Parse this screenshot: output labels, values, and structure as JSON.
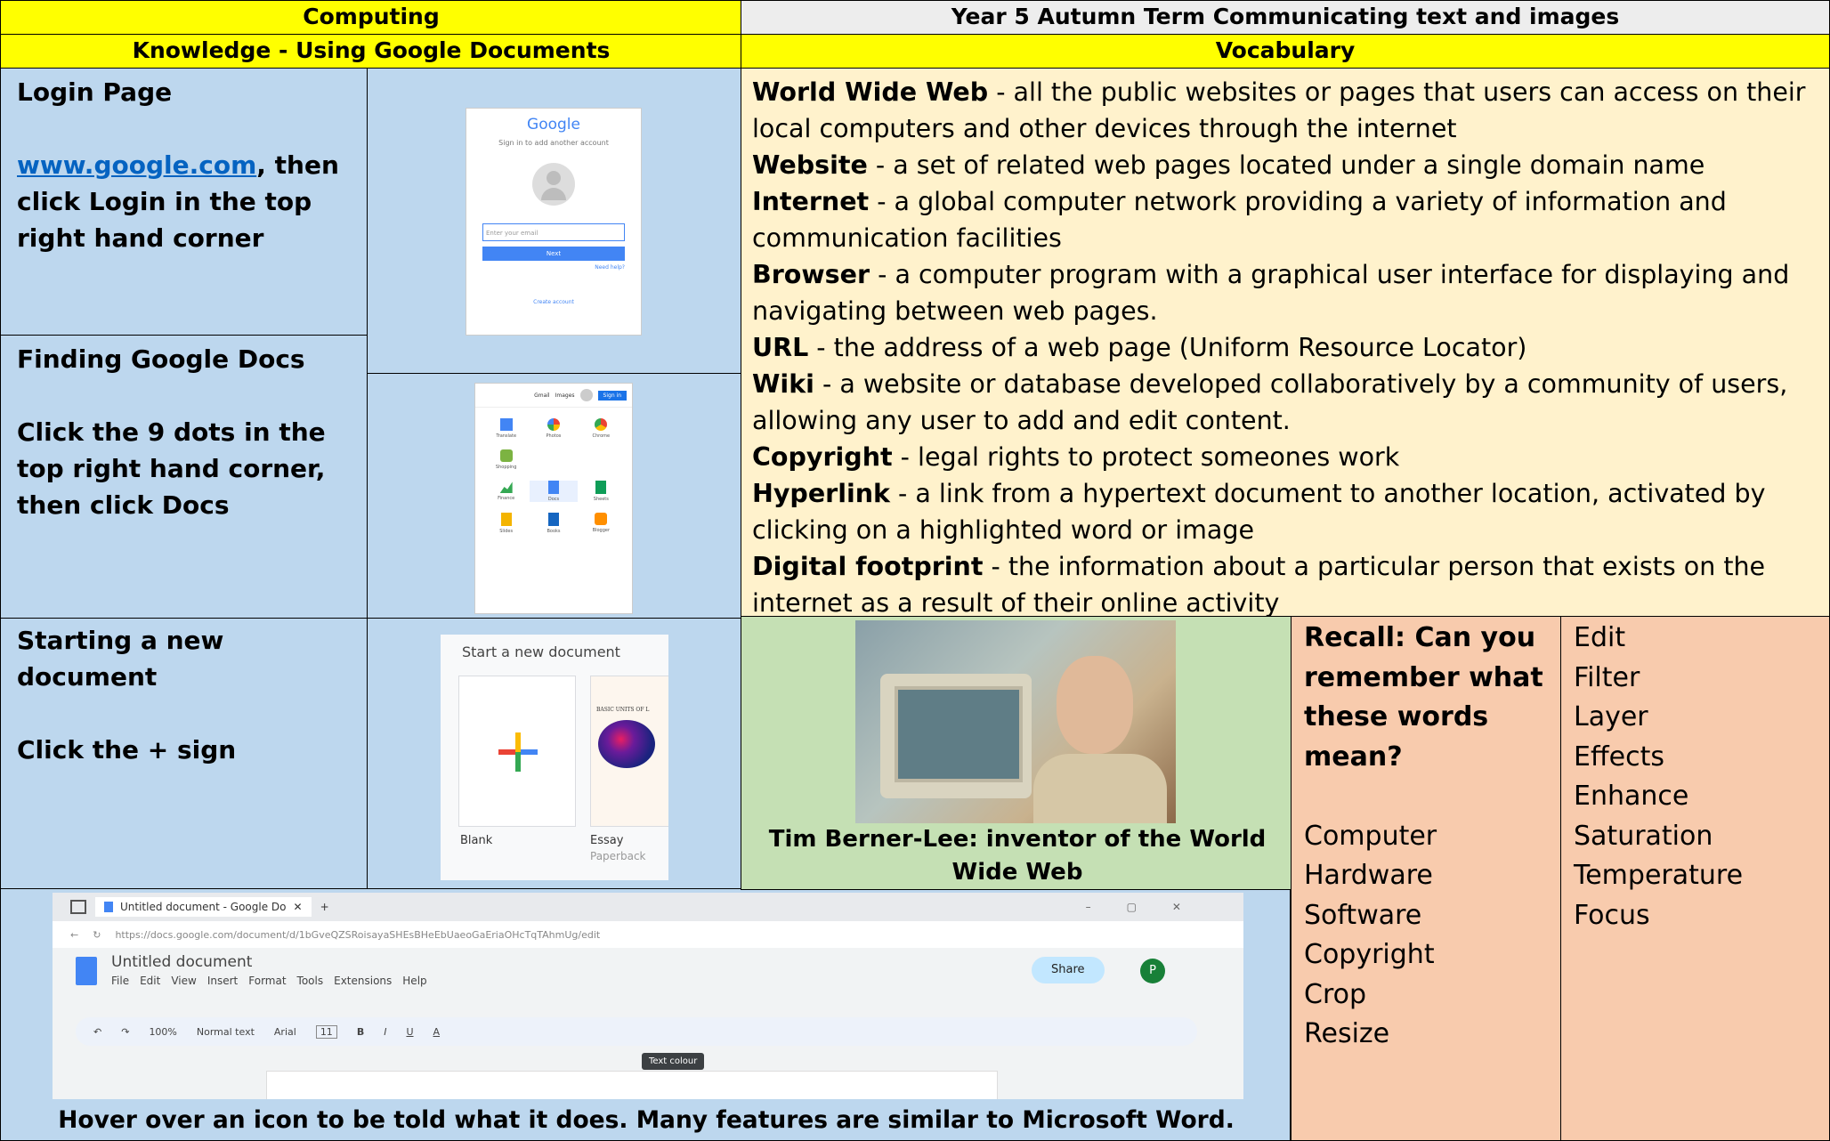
{
  "header": {
    "left_title": "Computing",
    "right_title": "Year 5 Autumn Term Communicating text and images",
    "left_subtitle": "Knowledge - Using Google Documents",
    "right_subtitle": "Vocabulary"
  },
  "knowledge": {
    "login": {
      "title": "Login Page",
      "link": "www.google.com",
      "after_link": ", then",
      "text": "click Login in the top right hand corner"
    },
    "finding": {
      "title": "Finding Google Docs",
      "text": "Click the 9 dots in the top right hand corner, then click Docs"
    },
    "starting": {
      "title": "Starting a new document",
      "text": "Click the + sign"
    },
    "hover_caption": "Hover over an icon to be told what it does. Many features are similar to Microsoft Word."
  },
  "login_screenshot": {
    "logo": "Google",
    "subtitle": "Sign in to add another account",
    "input_placeholder": "Enter your email",
    "button": "Next",
    "help": "Need help?",
    "create": "Create account"
  },
  "apps_screenshot": {
    "top_links": [
      "Gmail",
      "Images"
    ],
    "sign_in": "Sign in",
    "apps": [
      "Translate",
      "Photos",
      "Chrome",
      "Shopping",
      "Finance",
      "Docs",
      "Sheets",
      "Slides",
      "Books",
      "Blogger"
    ]
  },
  "new_doc_screenshot": {
    "title": "Start a new document",
    "blank_label": "Blank",
    "essay_label": "Essay",
    "essay_sub": "Paperback",
    "essay_head": "BASIC UNITS OF L"
  },
  "docs_screenshot": {
    "tab_title": "Untitled document - Google Do",
    "url": "https://docs.google.com/document/d/1bGveQZSRoisayaSHEsBHeEbUaeoGaEriaOHcTqTAhmUg/edit",
    "doc_title": "Untitled document",
    "menus": [
      "File",
      "Edit",
      "View",
      "Insert",
      "Format",
      "Tools",
      "Extensions",
      "Help"
    ],
    "share": "Share",
    "avatar": "P",
    "zoom": "100%",
    "style": "Normal text",
    "font": "Arial",
    "size": "11",
    "tooltip": "Text colour"
  },
  "vocabulary": [
    {
      "term": "World Wide Web",
      "def": " - all the public websites or pages that users can access on their local computers and other devices through the internet"
    },
    {
      "term": "Website",
      "def": " - a set of related web pages located under a single domain name"
    },
    {
      "term": "Internet",
      "def": " - a global computer network providing a variety of information and communication facilities"
    },
    {
      "term": "Browser",
      "def": " - a computer program with a graphical user interface for displaying and navigating between web pages."
    },
    {
      "term": "URL",
      "def": " - the address of a web page (Uniform Resource Locator)"
    },
    {
      "term": "Wiki",
      "def": " - a website or database developed collaboratively by a community of users, allowing any user to add and edit content."
    },
    {
      "term": "Copyright",
      "def": " - legal rights to protect someones work"
    },
    {
      "term": "Hyperlink",
      "def": " - a link from a hypertext document to another location, activated by clicking on a highlighted word or image"
    },
    {
      "term": "Digital footprint",
      "def": " - the information about a particular person that exists on the internet as a result of their online activity"
    }
  ],
  "photo_caption": "Tim Berner-Lee: inventor of the World Wide Web",
  "recall": {
    "title": "Recall: Can you remember what these words mean?",
    "col1": [
      "Computer",
      "Hardware",
      "Software",
      "Copyright",
      "Crop",
      "Resize"
    ],
    "col2": [
      "Edit",
      "Filter",
      "Layer",
      "Effects",
      "Enhance",
      "Saturation",
      "Temperature",
      "Focus"
    ]
  }
}
